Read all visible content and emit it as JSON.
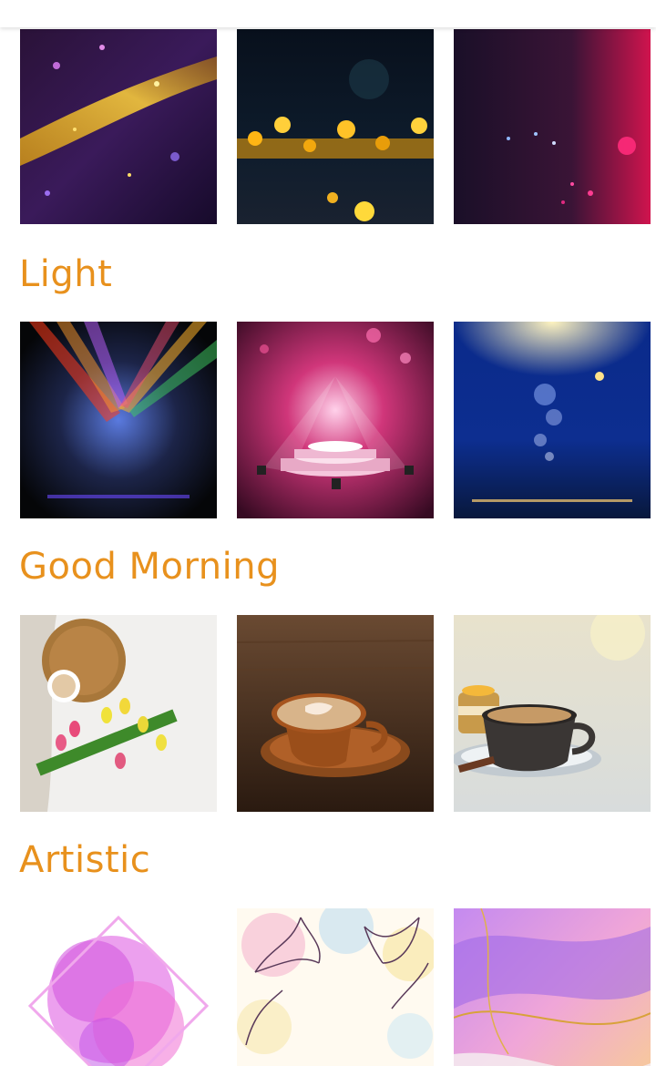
{
  "colors": {
    "title": "#e8911d",
    "background": "#ffffff"
  },
  "sections": [
    {
      "title": "",
      "partial": true,
      "tiles": [
        {
          "name": "gold-purple-glitter-bokeh"
        },
        {
          "name": "gold-bokeh-glitter-dark"
        },
        {
          "name": "pink-purple-glitter-bokeh"
        }
      ]
    },
    {
      "title": "Light",
      "tiles": [
        {
          "name": "colorful-stage-spotlights"
        },
        {
          "name": "pink-stage-podium-spotlights"
        },
        {
          "name": "blue-sparkle-light-rays"
        }
      ]
    },
    {
      "title": "Good Morning",
      "tiles": [
        {
          "name": "tulips-coffee-flatlay"
        },
        {
          "name": "latte-art-cup-wooden-table"
        },
        {
          "name": "coffee-cup-dessert-cafe"
        }
      ]
    },
    {
      "title": "Artistic",
      "tiles": [
        {
          "name": "pink-watercolor-splash-frame"
        },
        {
          "name": "floral-watercolor-line-art"
        },
        {
          "name": "purple-alcohol-ink-marble"
        }
      ]
    }
  ]
}
